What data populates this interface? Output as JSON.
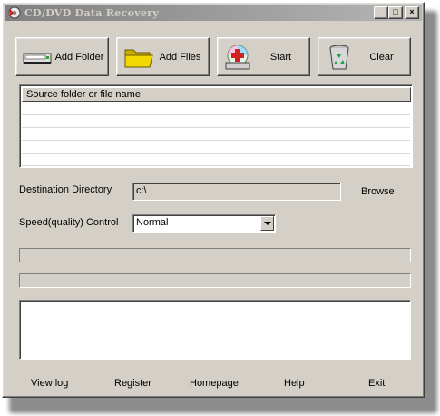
{
  "window": {
    "title": "CD/DVD Data Recovery",
    "controls": {
      "minimize": "_",
      "maximize": "□",
      "close": "×"
    }
  },
  "toolbar": [
    {
      "label": "Add Folder",
      "icon": "drive-icon"
    },
    {
      "label": "Add Files",
      "icon": "folder-icon"
    },
    {
      "label": "Start",
      "icon": "disc-start-icon"
    },
    {
      "label": "Clear",
      "icon": "recycle-bin-icon"
    }
  ],
  "list": {
    "column_header": "Source folder or file name",
    "rows": []
  },
  "destination": {
    "label": "Destination Directory",
    "value": "c:\\",
    "browse_label": "Browse"
  },
  "speed": {
    "label": "Speed(quality) Control",
    "selected": "Normal"
  },
  "progress": {
    "bar1": 0,
    "bar2": 0
  },
  "log": {
    "text": ""
  },
  "footer": [
    "View log",
    "Register",
    "Homepage",
    "Help",
    "Exit"
  ],
  "colors": {
    "face": "#d4d0c8",
    "title_gradient_start": "#808080",
    "title_gradient_end": "#b5b5b5",
    "folder_yellow": "#f0d800"
  }
}
